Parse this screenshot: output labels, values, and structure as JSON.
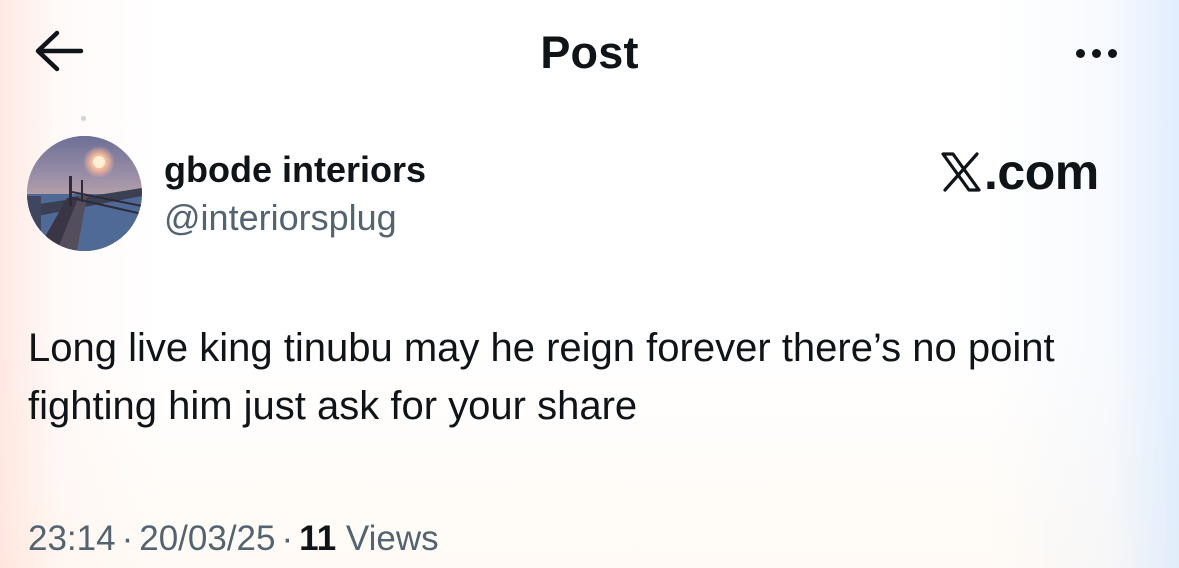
{
  "header": {
    "title": "Post",
    "back_icon": "arrow-left-icon",
    "more_icon": "more-horizontal-icon"
  },
  "author": {
    "display_name": "gbode interiors",
    "handle": "@interiorsplug",
    "avatar_icon": "sunset-pier-photo"
  },
  "watermark": {
    "logo_icon": "x-logo-icon",
    "text": ".com"
  },
  "post": {
    "text": "Long live king tinubu may he reign forever there’s no point fighting him just ask for your share"
  },
  "meta": {
    "time": "23:14",
    "date": "20/03/25",
    "separator": "·",
    "views_count": "11",
    "views_label": "Views"
  },
  "colors": {
    "text_primary": "#0f1419",
    "text_secondary": "#536471",
    "background": "#ffffff"
  }
}
